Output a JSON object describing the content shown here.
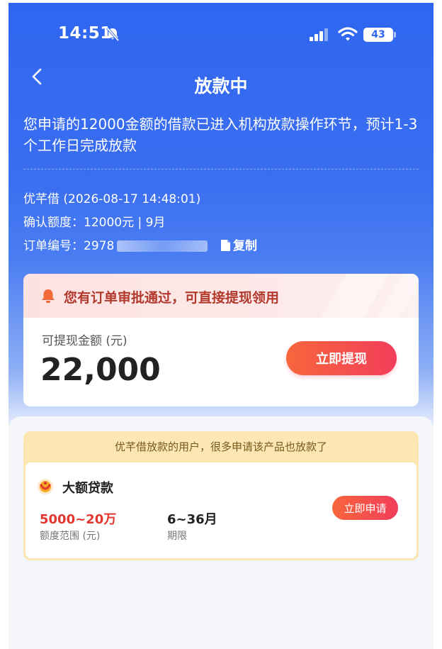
{
  "status_bar": {
    "time": "14:51",
    "battery": "43"
  },
  "header": {
    "title": "放款中"
  },
  "notice": "您申请的12000金额的借款已进入机构放款操作环节，预计1-3个工作日完成放款",
  "order": {
    "lender_line": "优芊借 (2026-08-17 14:48:01)",
    "credit_line": "确认额度：12000元 | 9月",
    "order_label": "订单编号：",
    "order_no_visible": "2978",
    "copy_label": "复制"
  },
  "approval_card": {
    "head_text": "您有订单审批通过，可直接提现领用",
    "avail_label": "可提现金额 (元)",
    "avail_amount": "22,000",
    "withdraw_button": "立即提现"
  },
  "recommend": {
    "head_text": "优芊借放款的用户，很多申请该产品也放款了",
    "product_name": "大额贷款",
    "amount_range": "5000~20万",
    "amount_label": "额度范围 (元)",
    "term": "6~36月",
    "term_label": "期限",
    "apply_button": "立即申请"
  },
  "colors": {
    "primary_blue": "#2f66f0",
    "accent_red": "#f23d5a",
    "amount_red": "#e2362f"
  },
  "icons": [
    "bell-off-icon",
    "signal-icon",
    "wifi-icon",
    "battery-icon",
    "back-arrow-icon",
    "copy-icon",
    "alarm-bell-icon",
    "product-logo-icon"
  ]
}
